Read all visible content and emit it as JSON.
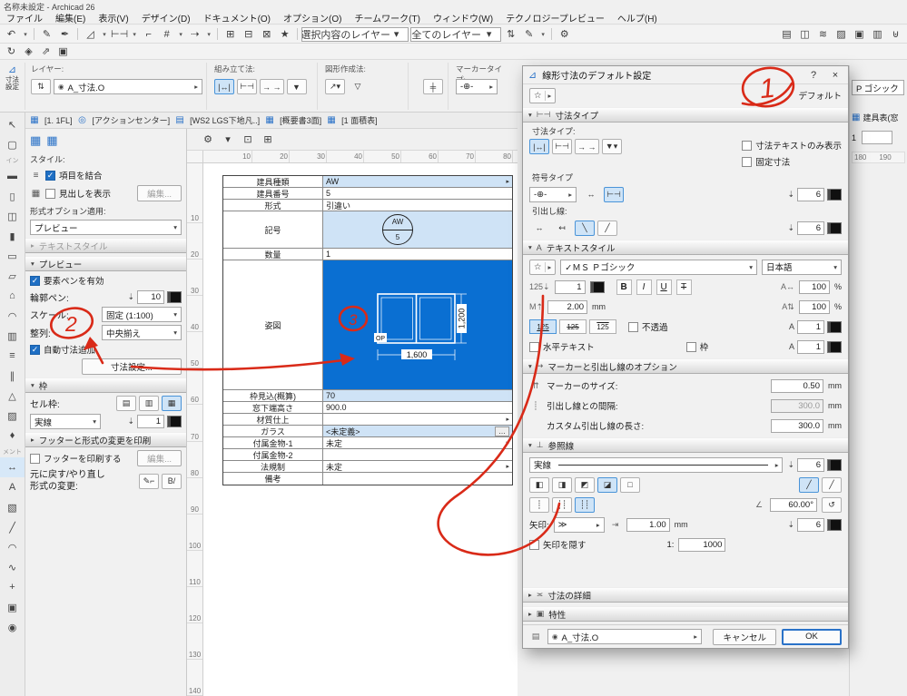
{
  "window": {
    "title": "名称未設定 - Archicad 26"
  },
  "g": {
    "tri_d": "▾",
    "tri_r": "▸",
    "star": "☆",
    "close": "×",
    "help": "?",
    "gear": "⚙",
    "eye": "◉",
    "dim": "⊿",
    "penDown": "⇣",
    "angle": "∠",
    "reset": "↺",
    "arrow2": "≫",
    "menu": "≡",
    "table": "▦",
    "layers": "▤",
    "updown": "⇅",
    "witness": "╪",
    "more": "…"
  },
  "menubar": [
    {
      "label": "ファイル",
      "n": "menu-file"
    },
    {
      "label": "編集(E)",
      "n": "menu-edit"
    },
    {
      "label": "表示(V)",
      "n": "menu-view"
    },
    {
      "label": "デザイン(D)",
      "n": "menu-design"
    },
    {
      "label": "ドキュメント(O)",
      "n": "menu-document"
    },
    {
      "label": "オプション(O)",
      "n": "menu-options"
    },
    {
      "label": "チームワーク(T)",
      "n": "menu-teamwork"
    },
    {
      "label": "ウィンドウ(W)",
      "n": "menu-window"
    },
    {
      "label": "テクノロジープレビュー",
      "n": "menu-tech-preview"
    },
    {
      "label": "ヘルプ(H)",
      "n": "menu-help"
    }
  ],
  "toolbar_top": {
    "left": [
      {
        "g": "↶",
        "n": "undo-icon"
      },
      {
        "g": "▾",
        "n": "undo-options-icon",
        "cls": "tiny"
      },
      {
        "cls": "sep",
        "i": 0
      },
      {
        "g": "✎",
        "n": "pickup-parameters-icon"
      },
      {
        "g": "✒",
        "n": "inject-parameters-icon"
      },
      {
        "cls": "sep",
        "i": 0
      },
      {
        "g": "◿",
        "n": "ruler-icon"
      },
      {
        "g": "▾",
        "n": "ruler-options-icon",
        "cls": "tiny"
      },
      {
        "g": "⊢⊣",
        "n": "snap-guides-icon"
      },
      {
        "g": "▾",
        "n": "snap-options-icon",
        "cls": "tiny"
      },
      {
        "g": "⌐",
        "n": "snap-point-icon"
      },
      {
        "g": "#",
        "n": "grid-snap-icon"
      },
      {
        "g": "▾",
        "n": "grid-options-icon",
        "cls": "tiny"
      },
      {
        "g": "⇢",
        "n": "gravity-icon"
      },
      {
        "g": "▾",
        "n": "gravity-options-icon",
        "cls": "tiny"
      },
      {
        "cls": "sep",
        "i": 0
      },
      {
        "g": "⊞",
        "n": "group-icon"
      },
      {
        "g": "⊟",
        "n": "ungroup-icon"
      },
      {
        "g": "⊠",
        "n": "suspend-groups-icon"
      },
      {
        "g": "★",
        "n": "magic-wand-icon"
      },
      {
        "cls": "sep",
        "i": 0
      }
    ],
    "filter1": "選択内容のレイヤー",
    "filter2": "全てのレイヤー",
    "rightA": [
      {
        "g": "⇅",
        "n": "quick-select-icon"
      },
      {
        "g": "✎",
        "n": "pen-tool-icon"
      },
      {
        "g": "▾",
        "n": "pen-options-icon",
        "cls": "tiny"
      },
      {
        "cls": "sep",
        "i": 0
      },
      {
        "g": "⚙",
        "n": "settings-icon"
      }
    ],
    "rightB": [
      {
        "g": "▤",
        "n": "layer-settings-icon"
      },
      {
        "g": "◫",
        "n": "composites-icon"
      },
      {
        "g": "≋",
        "n": "line-types-icon"
      },
      {
        "g": "▨",
        "n": "fill-types-icon"
      },
      {
        "g": "▣",
        "n": "profile-manager-icon"
      },
      {
        "g": "▥",
        "n": "surfaces-icon"
      },
      {
        "g": "⊎",
        "n": "favorites-icon"
      }
    ]
  },
  "toolbar_second": [
    {
      "g": "↻",
      "n": "rebuild-icon"
    },
    {
      "g": "◈",
      "n": "navigator-icon"
    },
    {
      "g": "⇗",
      "n": "publish-icon"
    },
    {
      "g": "▣",
      "n": "organizer-icon"
    }
  ],
  "infobar": {
    "tool_label": "寸法設定",
    "layer_label": "レイヤー:",
    "layer_value": "A_寸法.O",
    "construct_label": "組み立て法:",
    "construct_icons": [
      {
        "g": "|↔|",
        "n": "dim-linear-icon",
        "cls": "ib sel"
      },
      {
        "g": "⊢⊣",
        "n": "dim-chain-icon",
        "cls": "ib"
      },
      {
        "g": "→ →",
        "n": "dim-elevation-icon",
        "cls": "ib"
      },
      {
        "g": "▼",
        "n": "dim-marker-icon",
        "cls": "ib"
      }
    ],
    "geometry_label": "図形作成法:",
    "geometry_icons": [
      {
        "g": "↗▾",
        "n": "geometry-method-icon",
        "cls": "ib"
      },
      {
        "g": "▽",
        "n": "geometry-any-icon",
        "cls": "ibp"
      }
    ],
    "marker_label": "マーカータイプ:",
    "marker_value": "-⊕-"
  },
  "toolbox": [
    {
      "g": "↖",
      "n": "arrow-tool-icon"
    },
    {
      "g": "▢",
      "n": "marquee-tool-icon"
    },
    {
      "g": "イン",
      "n": "toolbox-group-design-label",
      "cls": "grp",
      "i": 0
    },
    {
      "g": "▬",
      "n": "wall-tool-icon"
    },
    {
      "g": "▯",
      "n": "door-tool-icon"
    },
    {
      "g": "◫",
      "n": "window-tool-icon"
    },
    {
      "g": "▮",
      "n": "column-tool-icon"
    },
    {
      "g": "▭",
      "n": "beam-tool-icon"
    },
    {
      "g": "▱",
      "n": "slab-tool-icon"
    },
    {
      "g": "⌂",
      "n": "roof-tool-icon"
    },
    {
      "g": "◠",
      "n": "shell-tool-icon"
    },
    {
      "g": "▥",
      "n": "curtain-wall-tool-icon"
    },
    {
      "g": "≡",
      "n": "stair-tool-icon"
    },
    {
      "g": "∥",
      "n": "railing-tool-icon"
    },
    {
      "g": "△",
      "n": "mesh-tool-icon"
    },
    {
      "g": "▨",
      "n": "zone-tool-icon"
    },
    {
      "g": "♦",
      "n": "object-tool-icon"
    },
    {
      "g": "メント",
      "n": "toolbox-group-document-label",
      "cls": "grp",
      "i": 0
    },
    {
      "g": "↔",
      "n": "dimension-tool-icon",
      "cls": "tsel"
    },
    {
      "g": "A",
      "n": "text-tool-icon"
    },
    {
      "g": "▧",
      "n": "fill-tool-icon"
    },
    {
      "g": "╱",
      "n": "line-tool-icon"
    },
    {
      "g": "◠",
      "n": "arc-tool-icon"
    },
    {
      "g": "∿",
      "n": "spline-tool-icon"
    },
    {
      "g": "+",
      "n": "hotspot-tool-icon"
    },
    {
      "g": "▣",
      "n": "figure-tool-icon"
    },
    {
      "g": "◉",
      "n": "camera-tool-icon"
    }
  ],
  "tabs": [
    {
      "g": "▦",
      "n": "tab-icon-plan",
      "cls": "tic"
    },
    {
      "label": "[1. 1FL]",
      "n": "tab-1fl",
      "cls": "tab"
    },
    {
      "g": "◎",
      "n": "tab-icon-action-center",
      "cls": "tic"
    },
    {
      "label": "[アクションセンター]",
      "n": "tab-action-center",
      "cls": "tab"
    },
    {
      "g": "▤",
      "n": "tab-icon-ws2",
      "cls": "tic"
    },
    {
      "label": "[WS2 LGS下地凡..]",
      "n": "tab-ws2",
      "cls": "tab"
    },
    {
      "g": "▦",
      "n": "tab-icon-gaiyou",
      "cls": "tic"
    },
    {
      "label": "[概要書3面]",
      "n": "tab-gaiyousho",
      "cls": "tab"
    },
    {
      "g": "▦",
      "n": "tab-icon-menseki",
      "cls": "tic"
    },
    {
      "label": "[1 面積表]",
      "n": "tab-mensekihyo",
      "cls": "tab"
    }
  ],
  "left_panel": {
    "top_icons": [
      {
        "g": "▦",
        "n": "schedule-view-icon"
      },
      {
        "g": "▦",
        "n": "schedule-edit-icon"
      }
    ],
    "style_label": "スタイル:",
    "merge": "項目を結合",
    "heading": "見出しを表示",
    "edit": "編集...",
    "format_label": "形式オプション適用:",
    "format_value": "プレビュー",
    "sec_text": "テキストスタイル",
    "sec_preview": "プレビュー",
    "elem_pen": "要素ペンを有効",
    "outline_label": "輪郭ペン:",
    "outline_pen": "10",
    "scale_label": "スケール:",
    "scale_value": "固定 (1:100)",
    "align_label": "整列:",
    "align_value": "中央揃え",
    "auto_dim": "自動寸法追加",
    "dim_btn": "寸法設定...",
    "sec_frame": "枠",
    "cell_label": "セル枠:",
    "cell_icons": [
      {
        "g": "▤",
        "n": "cell-border-horizontal-icon",
        "cls": "ib"
      },
      {
        "g": "▥",
        "n": "cell-border-vertical-icon",
        "cls": "ib"
      },
      {
        "g": "▦",
        "n": "cell-border-all-icon",
        "cls": "ib sel"
      }
    ],
    "line_value": "実線",
    "cell_pen": "1",
    "sec_footer": "フッターと形式の変更を印刷",
    "print_footer": "フッターを印刷する",
    "undo1": "元に戻す/やり直し",
    "undo2": "形式の変更:",
    "undo_icons": [
      {
        "g": "✎⌐",
        "n": "undo-format-icon",
        "cls": "ib"
      },
      {
        "g": "B/",
        "n": "redo-format-icon",
        "cls": "ib"
      }
    ]
  },
  "drawing": {
    "sub_icons": [
      {
        "g": "⚙",
        "n": "gear-icon"
      },
      {
        "g": "▾",
        "n": "gear-options-icon",
        "cls": "tiny"
      },
      {
        "g": "⊡",
        "n": "pane-layout-icon"
      },
      {
        "g": "⊞",
        "n": "split-view-icon"
      }
    ],
    "ruler_h": [
      {
        "g": "10",
        "n": "ruler-mark",
        "i": 0
      },
      {
        "g": "20",
        "n": "ruler-mark",
        "i": 0
      },
      {
        "g": "30",
        "n": "ruler-mark",
        "i": 0
      },
      {
        "g": "40",
        "n": "ruler-mark",
        "i": 0
      },
      {
        "g": "50",
        "n": "ruler-mark",
        "i": 0
      },
      {
        "g": "60",
        "n": "ruler-mark",
        "i": 0
      },
      {
        "g": "70",
        "n": "ruler-mark",
        "i": 0
      },
      {
        "g": "80",
        "n": "ruler-mark",
        "i": 0
      }
    ],
    "ruler_v": [
      {
        "g": "10",
        "n": "ruler-mark",
        "i": 0
      },
      {
        "g": "20",
        "n": "ruler-mark",
        "i": 0
      },
      {
        "g": "30",
        "n": "ruler-mark",
        "i": 0
      },
      {
        "g": "40",
        "n": "ruler-mark",
        "i": 0
      },
      {
        "g": "50",
        "n": "ruler-mark",
        "i": 0
      },
      {
        "g": "60",
        "n": "ruler-mark",
        "i": 0
      },
      {
        "g": "70",
        "n": "ruler-mark",
        "i": 0
      },
      {
        "g": "80",
        "n": "ruler-mark",
        "i": 0
      },
      {
        "g": "90",
        "n": "ruler-mark",
        "i": 0
      },
      {
        "g": "100",
        "n": "ruler-mark",
        "i": 0
      },
      {
        "g": "110",
        "n": "ruler-mark",
        "i": 0
      },
      {
        "g": "120",
        "n": "ruler-mark",
        "i": 0
      },
      {
        "g": "130",
        "n": "ruler-mark",
        "i": 0
      },
      {
        "g": "140",
        "n": "ruler-mark",
        "i": 0
      }
    ],
    "schedule": {
      "rows": [
        {
          "label": "建具種類",
          "value": "AW"
        },
        {
          "label": "建具番号",
          "value": "5"
        },
        {
          "label": "形式",
          "value": "引違い"
        },
        {
          "label": "記号",
          "value": ""
        },
        {
          "label": "数量",
          "value": "1"
        },
        {
          "label": "姿図",
          "value": ""
        },
        {
          "label": "枠見込(概算)",
          "value": "70"
        },
        {
          "label": "窓下端高さ",
          "value": "900.0"
        },
        {
          "label": "材質仕上",
          "value": ""
        },
        {
          "label": "ガラス",
          "value": "<未定義>"
        },
        {
          "label": "付属金物-1",
          "value": "未定"
        },
        {
          "label": "付属金物-2",
          "value": ""
        },
        {
          "label": "法規制",
          "value": "未定"
        },
        {
          "label": "備考",
          "value": ""
        }
      ],
      "symbol_top": "AW",
      "symbol_bottom": "5",
      "fig_w": "1,600",
      "fig_h": "1,200",
      "fig_op": "OP"
    }
  },
  "dialog": {
    "title": "線形寸法のデフォルト設定",
    "default_label": "デフォルト",
    "sec_dimtype": "寸法タイプ",
    "sec_dimtype_icon": "⊢⊣",
    "dimtype_label": "寸法タイプ:",
    "dimtype_icons": [
      {
        "g": "|↔|",
        "n": "dim-type-linear-icon",
        "cls": "ib sel"
      },
      {
        "g": "⊢⊣",
        "n": "dim-type-chain-icon",
        "cls": "ib"
      },
      {
        "g": "→ →",
        "n": "dim-type-elevation-icon",
        "cls": "ib"
      },
      {
        "g": "▼▾",
        "n": "dim-type-marker-icon",
        "cls": "ib"
      }
    ],
    "cb_text_only": "寸法テキストのみ表示",
    "cb_static": "固定寸法",
    "marker_type_label": "符号タイプ",
    "marker_value": "-⊕-",
    "marker_icons": [
      {
        "g": "↔",
        "n": "marker-plain-icon",
        "cls": "ibp"
      },
      {
        "g": "⊢⊣",
        "n": "marker-witness-icon",
        "cls": "ib sel"
      }
    ],
    "leader_label": "引出し線:",
    "leader_icons": [
      {
        "g": "↔",
        "n": "leader-none-icon",
        "cls": "ibp"
      },
      {
        "g": "↤",
        "n": "leader-auto-icon",
        "cls": "ibp"
      },
      {
        "g": "╲",
        "n": "leader-diagonal-icon",
        "cls": "ib sel"
      },
      {
        "g": "╱",
        "n": "leader-custom-icon",
        "cls": "ib"
      }
    ],
    "pen6": "6",
    "pen1": "1",
    "sec_text": "テキストスタイル",
    "sec_text_icon": "A",
    "font_value": "✓ＭＳ Ｐゴシック",
    "lang_value": "日本語",
    "fontsize_icon": "125⇣",
    "height_icon": "M⇡",
    "height_value": "2.00",
    "unit_mm": "mm",
    "unit_pct": "%",
    "bold": "B",
    "italic": "I",
    "underline": "U",
    "strike": "T",
    "width_icon": "A↔",
    "spacing_icon": "A⇅",
    "width_value": "100",
    "spacing_value": "100",
    "pos_chips": [
      {
        "g": "125",
        "n": "text-above-line-chip",
        "cls": "chip sel u"
      },
      {
        "g": "125",
        "n": "text-on-line-chip",
        "cls": "chip mid"
      },
      {
        "g": "125",
        "n": "text-below-line-chip",
        "cls": "chip o"
      }
    ],
    "cb_opaque": "不透過",
    "cb_horizontal": "水平テキスト",
    "cb_frame": "枠",
    "sec_marker": "マーカーと引出し線のオプション",
    "sec_marker_icon": "↦",
    "msize_icon": "⇈",
    "msize_label": "マーカーのサイズ:",
    "msize_value": "0.50",
    "gap_icon": "┊",
    "gap_label": "引出し線との間隔:",
    "gap_value": "300.0",
    "custom_label": "カスタム引出し線の長さ:",
    "custom_value": "300.0",
    "sec_witness": "参照線",
    "sec_witness_icon": "⊥",
    "linetype": "実線",
    "witness_icons": [
      {
        "g": "◧",
        "n": "witness-full-icon",
        "cls": "ib"
      },
      {
        "g": "◨",
        "n": "witness-half-icon",
        "cls": "ib"
      },
      {
        "g": "◩",
        "n": "witness-gap-icon",
        "cls": "ib"
      },
      {
        "g": "◪",
        "n": "witness-fixed-icon",
        "cls": "ib sel"
      },
      {
        "g": "□",
        "n": "witness-none-icon",
        "cls": "ib"
      }
    ],
    "witness_pair": [
      {
        "g": "╱",
        "n": "witness-perpendicular-icon",
        "cls": "ib sel"
      },
      {
        "g": "╱",
        "n": "witness-slanted-icon",
        "cls": "ib"
      }
    ],
    "dash_icons": [
      {
        "g": "┊",
        "n": "witness-dash-none-icon",
        "cls": "ib"
      },
      {
        "g": "┊┊",
        "n": "witness-dash-short-icon",
        "cls": "ib"
      },
      {
        "g": "┊┊",
        "n": "witness-dash-long-icon",
        "cls": "ib sel"
      }
    ],
    "angle_value": "60.00°",
    "arrow_label": "矢印:",
    "arrow_size_icon": "⇥",
    "arrow_size": "1.00",
    "cb_hide": "矢印を隠す",
    "ratio_label": "1:",
    "ratio_value": "1000",
    "sec_details": "寸法の詳細",
    "sec_details_icon": "≍",
    "sec_props": "特性",
    "sec_props_icon": "▣",
    "layer": "A_寸法.O",
    "cancel": "キャンセル",
    "ok": "OK"
  },
  "right_strip": {
    "font": "P ゴシック",
    "item": "建具表(窓",
    "num": "1",
    "r1": "180",
    "r2": "190"
  },
  "annotations": {
    "n1": "1",
    "n2": "2",
    "n3": "3"
  }
}
